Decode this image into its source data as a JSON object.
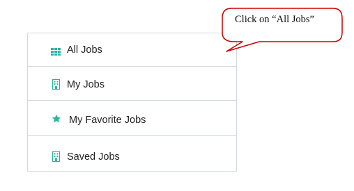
{
  "menu": {
    "items": [
      {
        "label": "All Jobs",
        "icon": "grid-icon"
      },
      {
        "label": "My Jobs",
        "icon": "building-icon"
      },
      {
        "label": "My Favorite Jobs",
        "icon": "star-icon"
      },
      {
        "label": "Saved Jobs",
        "icon": "building-icon"
      }
    ]
  },
  "callout": {
    "text": "Click on “All Jobs”",
    "border_color": "#cc0000"
  },
  "colors": {
    "icon_teal": "#2ab3a1",
    "border": "#cfd8dc"
  }
}
